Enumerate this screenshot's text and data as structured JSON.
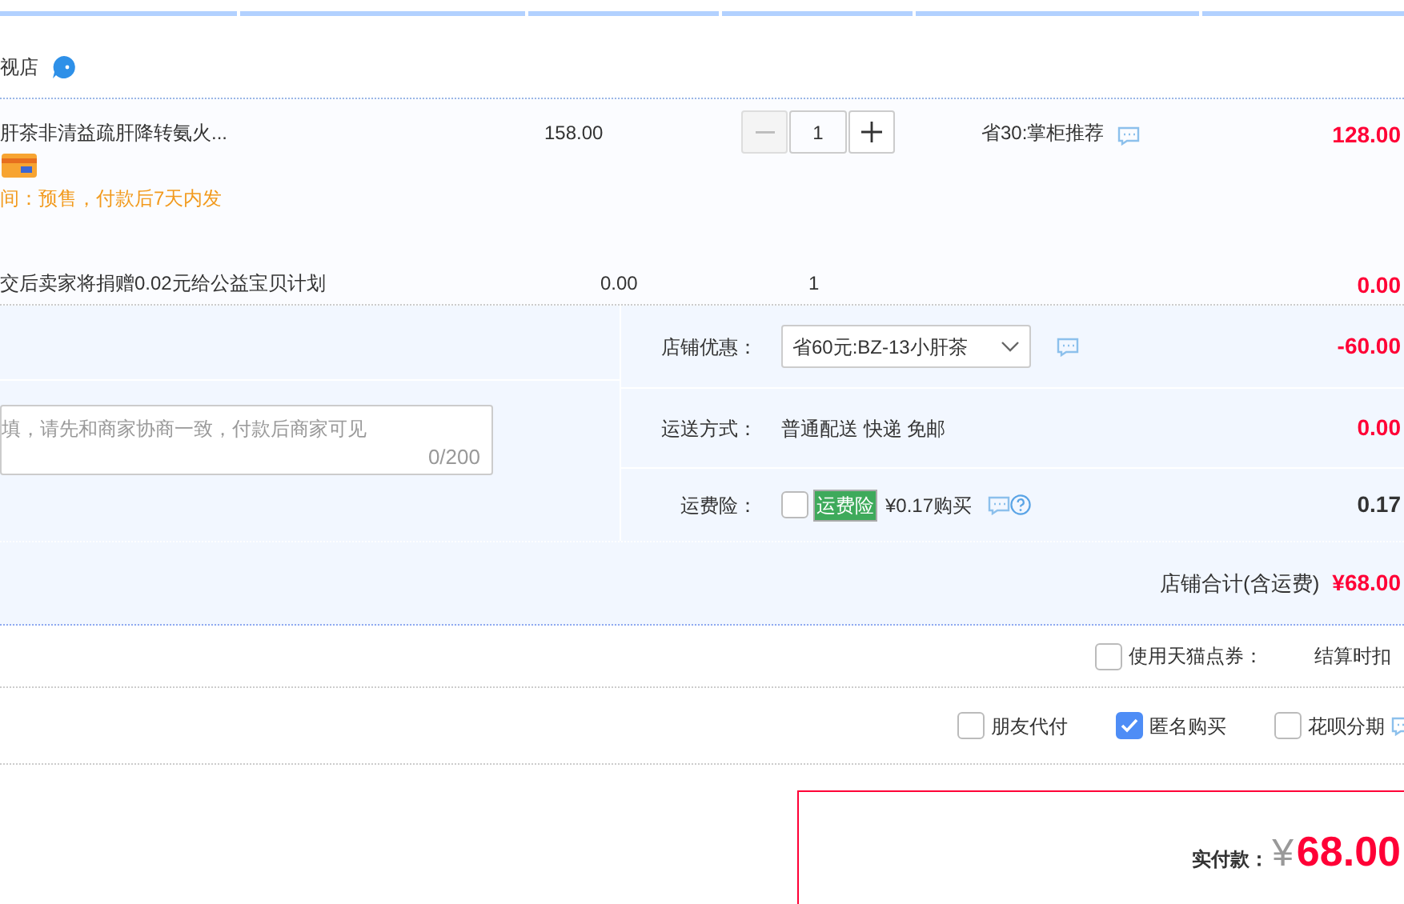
{
  "store": {
    "name": "视店"
  },
  "items": [
    {
      "kind": "product",
      "title": "肝茶非清益疏肝降转氨火...",
      "note": "间：预售，付款后7天内发",
      "price": "158.00",
      "quantity": "1",
      "discount": "省30:掌柜推荐",
      "total": "128.00"
    },
    {
      "kind": "charity",
      "title": "交后卖家将捐赠0.02元给公益宝贝计划",
      "price": "0.00",
      "quantity": "1",
      "total": "0.00"
    }
  ],
  "message": {
    "placeholder": "填，请先和商家协商一致，付款后商家可见",
    "counter": "0/200"
  },
  "store_discount": {
    "label": "店铺优惠：",
    "selected_option": "省60元:BZ-13小肝茶",
    "amount": "-60.00"
  },
  "shipping": {
    "label": "运送方式：",
    "value": "普通配送 快递 免邮",
    "amount": "0.00"
  },
  "insurance": {
    "label": "运费险：",
    "checked": false,
    "tag": "运费险",
    "price": "¥0.17购买",
    "amount": "0.17"
  },
  "store_total": {
    "label": "店铺合计(含运费)",
    "amount": "¥68.00"
  },
  "coupon": {
    "label": "使用天猫点券：",
    "checked": false,
    "note": "结算时扣"
  },
  "options": [
    {
      "label": "朋友代付",
      "checked": false
    },
    {
      "label": "匿名购买",
      "checked": true
    },
    {
      "label": "花呗分期",
      "checked": false
    }
  ],
  "payment": {
    "label": "实付款：",
    "currency": "¥",
    "amount": "68.00"
  }
}
